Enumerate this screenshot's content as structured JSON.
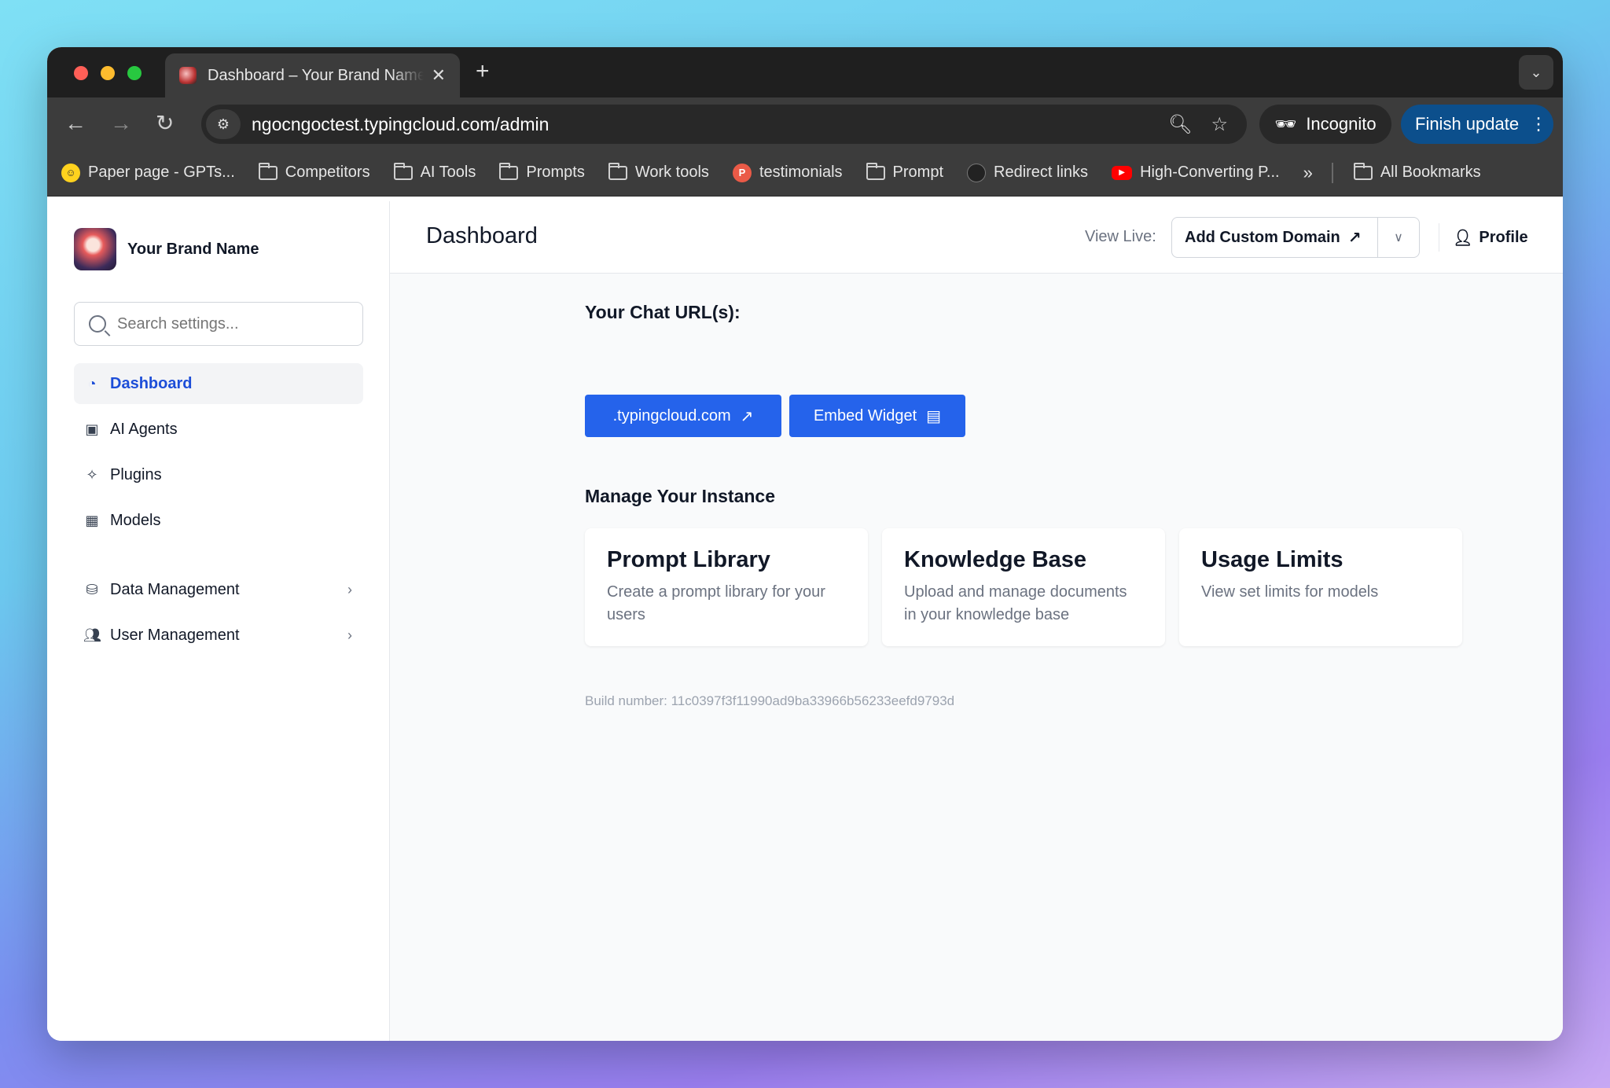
{
  "browser": {
    "tab_title": "Dashboard – Your Brand Name",
    "tab_close": "✕",
    "new_tab": "+",
    "url": "ngocngoctest.typingcloud.com/admin",
    "incognito_label": "Incognito",
    "finish_update_label": "Finish update",
    "bookmarks": [
      {
        "label": "Paper page - GPTs...",
        "icon": "hugging-face-icon"
      },
      {
        "label": "Competitors",
        "icon": "folder-icon"
      },
      {
        "label": "AI Tools",
        "icon": "folder-icon"
      },
      {
        "label": "Prompts",
        "icon": "folder-icon"
      },
      {
        "label": "Work tools",
        "icon": "folder-icon"
      },
      {
        "label": "testimonials",
        "icon": "producthunt-icon"
      },
      {
        "label": "Prompt",
        "icon": "folder-icon"
      },
      {
        "label": "Redirect links",
        "icon": "github-icon"
      },
      {
        "label": "High-Converting P...",
        "icon": "youtube-icon"
      }
    ],
    "overflow": "»",
    "all_bookmarks": "All Bookmarks"
  },
  "sidebar": {
    "brand_name": "Your Brand Name",
    "search_placeholder": "Search settings...",
    "items": [
      {
        "label": "Dashboard",
        "icon": "pie-chart-icon",
        "active": true
      },
      {
        "label": "AI Agents",
        "icon": "robot-icon"
      },
      {
        "label": "Plugins",
        "icon": "puzzle-icon"
      },
      {
        "label": "Models",
        "icon": "chip-icon"
      },
      {
        "label": "Data Management",
        "icon": "database-icon",
        "expandable": true
      },
      {
        "label": "User Management",
        "icon": "users-icon",
        "expandable": true
      }
    ]
  },
  "header": {
    "title": "Dashboard",
    "view_live_label": "View Live:",
    "domain_button": "Add Custom Domain",
    "profile_label": "Profile"
  },
  "main": {
    "chat_urls_title": "Your Chat URL(s):",
    "url_button": ".typingcloud.com",
    "embed_button": "Embed Widget",
    "manage_title": "Manage Your Instance",
    "cards": [
      {
        "title": "Prompt Library",
        "desc": "Create a prompt library for your users"
      },
      {
        "title": "Knowledge Base",
        "desc": "Upload and manage documents in your knowledge base"
      },
      {
        "title": "Usage Limits",
        "desc": "View set limits for models"
      }
    ],
    "build_number": "Build number: 11c0397f3f11990ad9ba33966b56233eefd9793d"
  },
  "colors": {
    "primary": "#2563eb",
    "active_nav": "#1d4ed8",
    "finish_update": "#0c4f8c"
  }
}
